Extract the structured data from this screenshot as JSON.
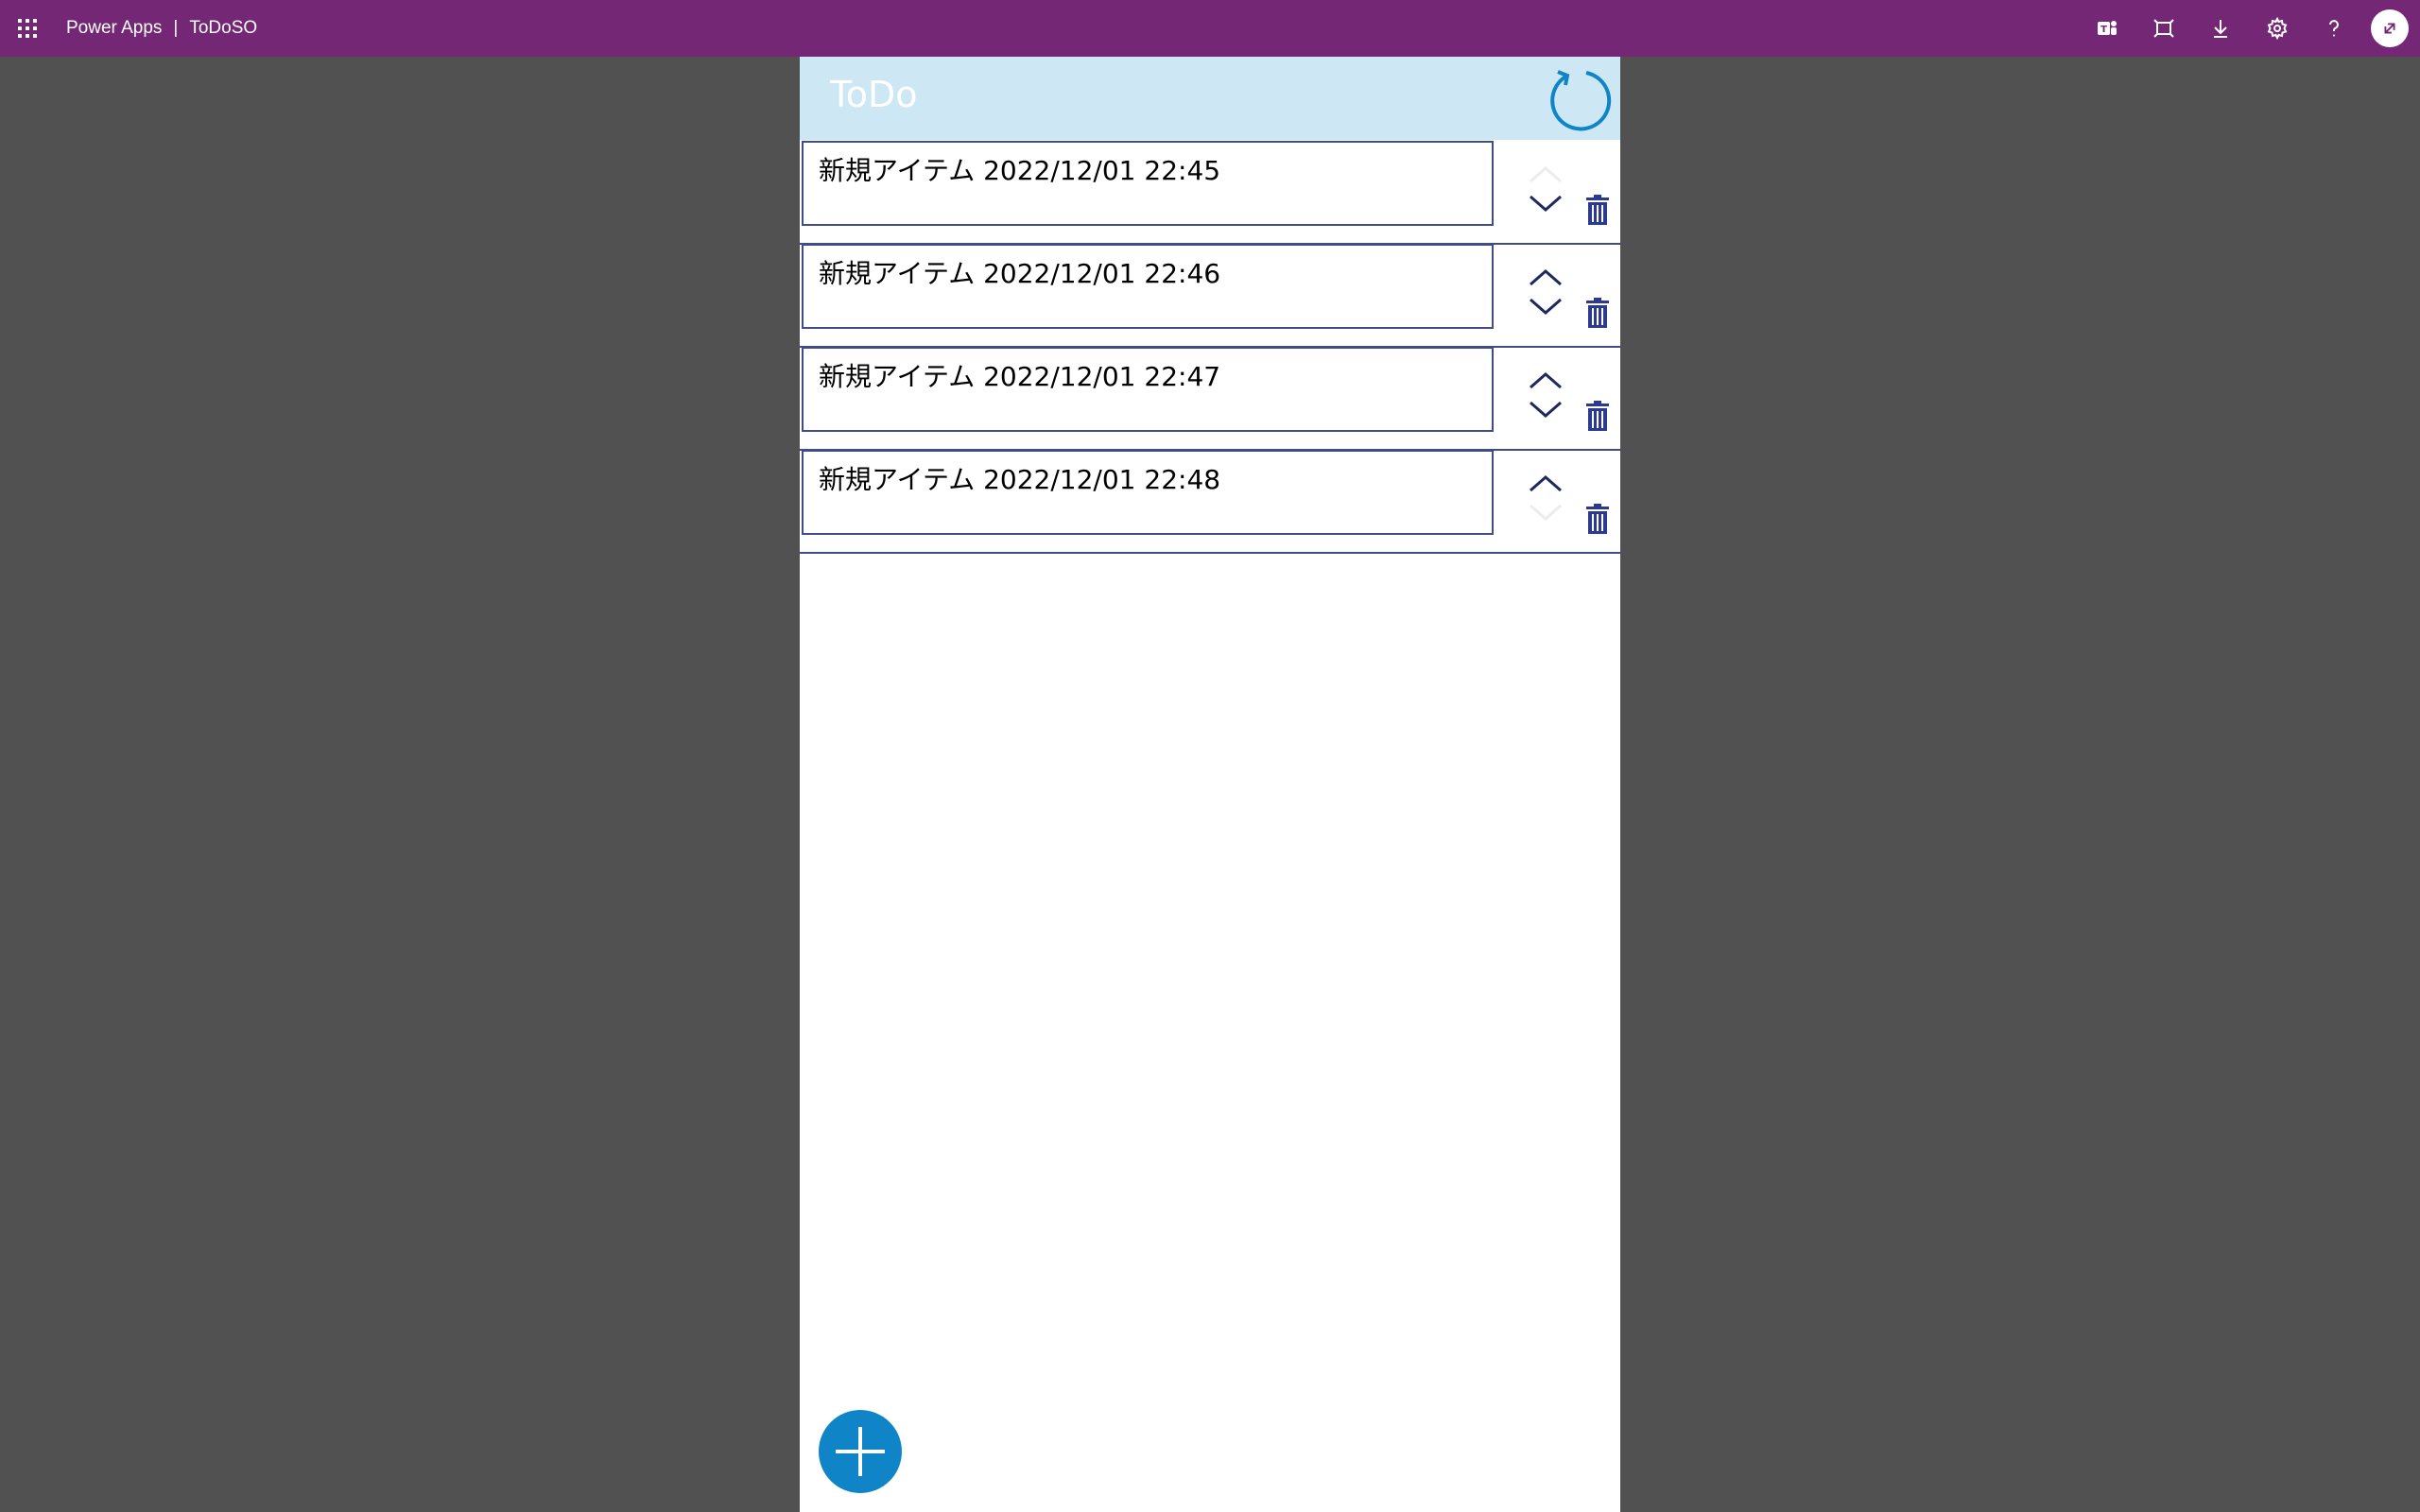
{
  "header": {
    "app_name": "Power Apps",
    "separator": "|",
    "app_title": "ToDoSO",
    "icons": [
      "waffle-icon",
      "teams-icon",
      "fit-to-window-icon",
      "download-icon",
      "settings-icon",
      "help-icon",
      "avatar"
    ]
  },
  "app": {
    "title": "ToDo",
    "items": [
      {
        "text": "新規アイテム 2022/12/01 22:45",
        "up_visible": false,
        "down_visible": true
      },
      {
        "text": "新規アイテム 2022/12/01 22:46",
        "up_visible": true,
        "down_visible": true
      },
      {
        "text": "新規アイテム 2022/12/01 22:47",
        "up_visible": true,
        "down_visible": true
      },
      {
        "text": "新規アイテム 2022/12/01 22:48",
        "up_visible": true,
        "down_visible": false
      }
    ]
  },
  "colors": {
    "topbar": "#742774",
    "canvas_bg": "#515151",
    "header_bg": "#cde7f5",
    "accent": "#0f85c7",
    "border": "#3e4c8c"
  }
}
